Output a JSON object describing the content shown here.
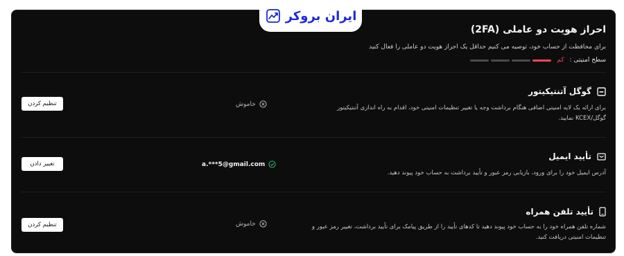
{
  "brand": {
    "logo_text": "ایران بروکر",
    "logo_color": "#1b2bd8",
    "icon": "trend-chart-icon"
  },
  "header": {
    "title": "احراز هویت دو عاملی (2FA)",
    "subtitle": "برای محافظت از حساب خود، توصیه می کنیم حداقل یک احراز هویت دو عاملی را فعال کنید",
    "level_label": "سطح امنیتی :",
    "level_value": "کم",
    "level_segments_active": 1,
    "level_segments_total": 4,
    "level_color": "#f04a53"
  },
  "methods": [
    {
      "title": "گوگل آتنتیکیتور",
      "icon": "authenticator-icon",
      "description": "برای ارائه یک لایه امنیتی اضافی هنگام برداشت وجه یا تغییر تنظیمات امنیتی خود، اقدام به راه اندازی آتنتیکیتور گوگل/KCEX نمایید.",
      "status_text": "خاموش",
      "status_icon": "off-x-icon",
      "button_label": "تنظیم کردن"
    },
    {
      "title": "تأیید ایمیل",
      "icon": "email-icon",
      "description": "آدرس ایمیل خود را برای ورود، بازیابی رمز عبور و تأیید برداشت به حساب خود پیوند دهید.",
      "status_text": "a.***5@gmail.com",
      "status_icon": "verified-check-icon",
      "button_label": "تغییر دادن"
    },
    {
      "title": "تأیید تلفن همراه",
      "icon": "phone-icon",
      "description": "شماره تلفن همراه خود را به حساب خود پیوند دهید تا کدهای تأیید را از طریق پیامک برای تأیید برداشت، تغییر رمز عبور و تنظیمات امنیتی دریافت کنید.",
      "status_text": "خاموش",
      "status_icon": "off-x-icon",
      "button_label": "تنظیم کردن"
    }
  ]
}
